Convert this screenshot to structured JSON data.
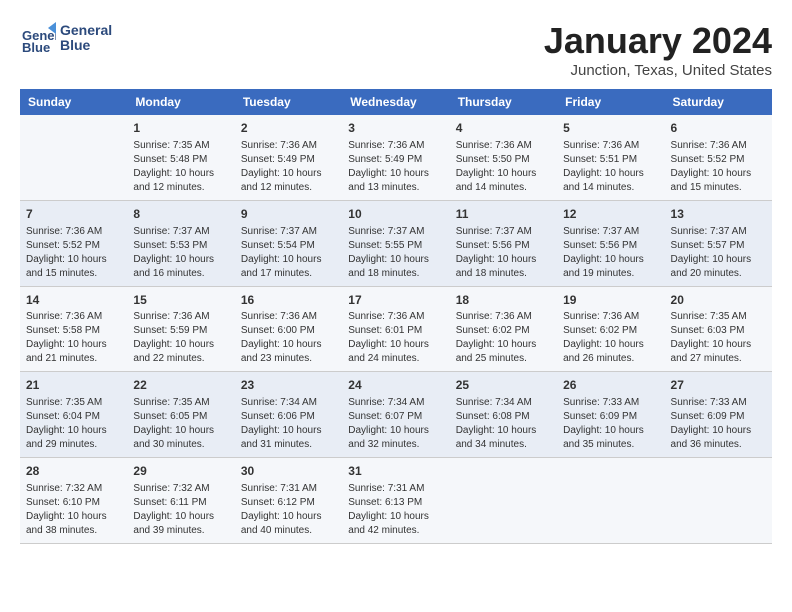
{
  "header": {
    "logo_line1": "General",
    "logo_line2": "Blue",
    "month": "January 2024",
    "location": "Junction, Texas, United States"
  },
  "weekdays": [
    "Sunday",
    "Monday",
    "Tuesday",
    "Wednesday",
    "Thursday",
    "Friday",
    "Saturday"
  ],
  "weeks": [
    [
      {
        "day": "",
        "content": ""
      },
      {
        "day": "1",
        "content": "Sunrise: 7:35 AM\nSunset: 5:48 PM\nDaylight: 10 hours\nand 12 minutes."
      },
      {
        "day": "2",
        "content": "Sunrise: 7:36 AM\nSunset: 5:49 PM\nDaylight: 10 hours\nand 12 minutes."
      },
      {
        "day": "3",
        "content": "Sunrise: 7:36 AM\nSunset: 5:49 PM\nDaylight: 10 hours\nand 13 minutes."
      },
      {
        "day": "4",
        "content": "Sunrise: 7:36 AM\nSunset: 5:50 PM\nDaylight: 10 hours\nand 14 minutes."
      },
      {
        "day": "5",
        "content": "Sunrise: 7:36 AM\nSunset: 5:51 PM\nDaylight: 10 hours\nand 14 minutes."
      },
      {
        "day": "6",
        "content": "Sunrise: 7:36 AM\nSunset: 5:52 PM\nDaylight: 10 hours\nand 15 minutes."
      }
    ],
    [
      {
        "day": "7",
        "content": "Sunrise: 7:36 AM\nSunset: 5:52 PM\nDaylight: 10 hours\nand 15 minutes."
      },
      {
        "day": "8",
        "content": "Sunrise: 7:37 AM\nSunset: 5:53 PM\nDaylight: 10 hours\nand 16 minutes."
      },
      {
        "day": "9",
        "content": "Sunrise: 7:37 AM\nSunset: 5:54 PM\nDaylight: 10 hours\nand 17 minutes."
      },
      {
        "day": "10",
        "content": "Sunrise: 7:37 AM\nSunset: 5:55 PM\nDaylight: 10 hours\nand 18 minutes."
      },
      {
        "day": "11",
        "content": "Sunrise: 7:37 AM\nSunset: 5:56 PM\nDaylight: 10 hours\nand 18 minutes."
      },
      {
        "day": "12",
        "content": "Sunrise: 7:37 AM\nSunset: 5:56 PM\nDaylight: 10 hours\nand 19 minutes."
      },
      {
        "day": "13",
        "content": "Sunrise: 7:37 AM\nSunset: 5:57 PM\nDaylight: 10 hours\nand 20 minutes."
      }
    ],
    [
      {
        "day": "14",
        "content": "Sunrise: 7:36 AM\nSunset: 5:58 PM\nDaylight: 10 hours\nand 21 minutes."
      },
      {
        "day": "15",
        "content": "Sunrise: 7:36 AM\nSunset: 5:59 PM\nDaylight: 10 hours\nand 22 minutes."
      },
      {
        "day": "16",
        "content": "Sunrise: 7:36 AM\nSunset: 6:00 PM\nDaylight: 10 hours\nand 23 minutes."
      },
      {
        "day": "17",
        "content": "Sunrise: 7:36 AM\nSunset: 6:01 PM\nDaylight: 10 hours\nand 24 minutes."
      },
      {
        "day": "18",
        "content": "Sunrise: 7:36 AM\nSunset: 6:02 PM\nDaylight: 10 hours\nand 25 minutes."
      },
      {
        "day": "19",
        "content": "Sunrise: 7:36 AM\nSunset: 6:02 PM\nDaylight: 10 hours\nand 26 minutes."
      },
      {
        "day": "20",
        "content": "Sunrise: 7:35 AM\nSunset: 6:03 PM\nDaylight: 10 hours\nand 27 minutes."
      }
    ],
    [
      {
        "day": "21",
        "content": "Sunrise: 7:35 AM\nSunset: 6:04 PM\nDaylight: 10 hours\nand 29 minutes."
      },
      {
        "day": "22",
        "content": "Sunrise: 7:35 AM\nSunset: 6:05 PM\nDaylight: 10 hours\nand 30 minutes."
      },
      {
        "day": "23",
        "content": "Sunrise: 7:34 AM\nSunset: 6:06 PM\nDaylight: 10 hours\nand 31 minutes."
      },
      {
        "day": "24",
        "content": "Sunrise: 7:34 AM\nSunset: 6:07 PM\nDaylight: 10 hours\nand 32 minutes."
      },
      {
        "day": "25",
        "content": "Sunrise: 7:34 AM\nSunset: 6:08 PM\nDaylight: 10 hours\nand 34 minutes."
      },
      {
        "day": "26",
        "content": "Sunrise: 7:33 AM\nSunset: 6:09 PM\nDaylight: 10 hours\nand 35 minutes."
      },
      {
        "day": "27",
        "content": "Sunrise: 7:33 AM\nSunset: 6:09 PM\nDaylight: 10 hours\nand 36 minutes."
      }
    ],
    [
      {
        "day": "28",
        "content": "Sunrise: 7:32 AM\nSunset: 6:10 PM\nDaylight: 10 hours\nand 38 minutes."
      },
      {
        "day": "29",
        "content": "Sunrise: 7:32 AM\nSunset: 6:11 PM\nDaylight: 10 hours\nand 39 minutes."
      },
      {
        "day": "30",
        "content": "Sunrise: 7:31 AM\nSunset: 6:12 PM\nDaylight: 10 hours\nand 40 minutes."
      },
      {
        "day": "31",
        "content": "Sunrise: 7:31 AM\nSunset: 6:13 PM\nDaylight: 10 hours\nand 42 minutes."
      },
      {
        "day": "",
        "content": ""
      },
      {
        "day": "",
        "content": ""
      },
      {
        "day": "",
        "content": ""
      }
    ]
  ]
}
